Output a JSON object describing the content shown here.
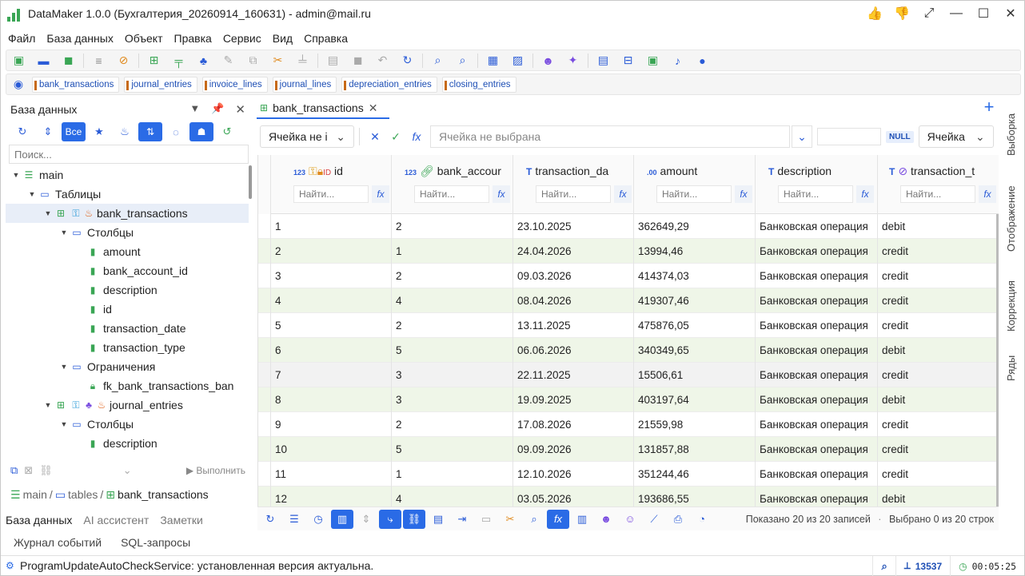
{
  "window": {
    "title": "DataMaker 1.0.0 (Бухгалтерия_20260914_160631) - admin@mail.ru"
  },
  "menu": [
    "Файл",
    "База данных",
    "Объект",
    "Правка",
    "Сервис",
    "Вид",
    "Справка"
  ],
  "table_tabs": [
    "bank_transactions",
    "journal_entries",
    "invoice_lines",
    "journal_lines",
    "depreciation_entries",
    "closing_entries"
  ],
  "left_panel": {
    "title": "База данных",
    "all_button": "Все",
    "search_placeholder": "Поиск...",
    "run_label": "▶ Выполнить",
    "tree": [
      {
        "label": "main",
        "level": 0,
        "icon": "database-icon"
      },
      {
        "label": "Таблицы",
        "level": 1,
        "icon": "folder-icon"
      },
      {
        "label": "bank_transactions",
        "level": 2,
        "icon": "table-icon",
        "selected": true
      },
      {
        "label": "Столбцы",
        "level": 3,
        "icon": "folder-icon"
      },
      {
        "label": "amount",
        "level": 4,
        "icon": "column-icon"
      },
      {
        "label": "bank_account_id",
        "level": 4,
        "icon": "column-icon"
      },
      {
        "label": "description",
        "level": 4,
        "icon": "column-icon"
      },
      {
        "label": "id",
        "level": 4,
        "icon": "column-icon"
      },
      {
        "label": "transaction_date",
        "level": 4,
        "icon": "column-icon"
      },
      {
        "label": "transaction_type",
        "level": 4,
        "icon": "column-icon"
      },
      {
        "label": "Ограничения",
        "level": 3,
        "icon": "folder-icon"
      },
      {
        "label": "fk_bank_transactions_ban",
        "level": 4,
        "icon": "constraint-icon"
      },
      {
        "label": "journal_entries",
        "level": 2,
        "icon": "table-icon"
      },
      {
        "label": "Столбцы",
        "level": 3,
        "icon": "folder-icon"
      },
      {
        "label": "description",
        "level": 4,
        "icon": "column-icon"
      }
    ],
    "breadcrumb": {
      "db": "main",
      "sep1": "/",
      "folder": "tables",
      "sep2": "/",
      "table": "bank_transactions"
    },
    "bottom_tabs": [
      "База данных",
      "AI ассистент",
      "Заметки"
    ],
    "bottom_tabs2": [
      "Журнал событий",
      "SQL-запросы"
    ]
  },
  "editor": {
    "tab_label": "bank_transactions",
    "close": "✕",
    "filter": {
      "cell_select": "Ячейка не і",
      "value_placeholder": "Ячейка не выбрана",
      "null_label": "NULL",
      "mode_select": "Ячейка"
    },
    "find_placeholder": "Найти...",
    "columns": [
      {
        "name": "id",
        "type": "123"
      },
      {
        "name": "bank_accour",
        "type": "123"
      },
      {
        "name": "transaction_da",
        "type": "T"
      },
      {
        "name": "amount",
        "type": ".00"
      },
      {
        "name": "description",
        "type": "T"
      },
      {
        "name": "transaction_t",
        "type": "T"
      }
    ],
    "rows": [
      [
        "1",
        "2",
        "23.10.2025",
        "362649,29",
        "Банковская операция",
        "debit"
      ],
      [
        "2",
        "1",
        "24.04.2026",
        "13994,46",
        "Банковская операция",
        "credit"
      ],
      [
        "3",
        "2",
        "09.03.2026",
        "414374,03",
        "Банковская операция",
        "credit"
      ],
      [
        "4",
        "4",
        "08.04.2026",
        "419307,46",
        "Банковская операция",
        "credit"
      ],
      [
        "5",
        "2",
        "13.11.2025",
        "475876,05",
        "Банковская операция",
        "credit"
      ],
      [
        "6",
        "5",
        "06.06.2026",
        "340349,65",
        "Банковская операция",
        "debit"
      ],
      [
        "7",
        "3",
        "22.11.2025",
        "15506,61",
        "Банковская операция",
        "credit"
      ],
      [
        "8",
        "3",
        "19.09.2025",
        "403197,64",
        "Банковская операция",
        "debit"
      ],
      [
        "9",
        "2",
        "17.08.2026",
        "21559,98",
        "Банковская операция",
        "credit"
      ],
      [
        "10",
        "5",
        "09.09.2026",
        "131857,88",
        "Банковская операция",
        "credit"
      ],
      [
        "11",
        "1",
        "12.10.2026",
        "351244,46",
        "Банковская операция",
        "credit"
      ],
      [
        "12",
        "4",
        "03.05.2026",
        "193686,55",
        "Банковская операция",
        "debit"
      ]
    ],
    "status_shown": "Показано 20 из 20 записей",
    "status_sep": "·",
    "status_selected": "Выбрано 0 из 20 строк"
  },
  "side_tabs": [
    "Выборка",
    "Отображение",
    "Коррекция",
    "Ряды"
  ],
  "statusbar": {
    "message": "ProgramUpdateAutoCheckService: установленная версия актуальна.",
    "count": "13537",
    "time": "00:05:25"
  }
}
